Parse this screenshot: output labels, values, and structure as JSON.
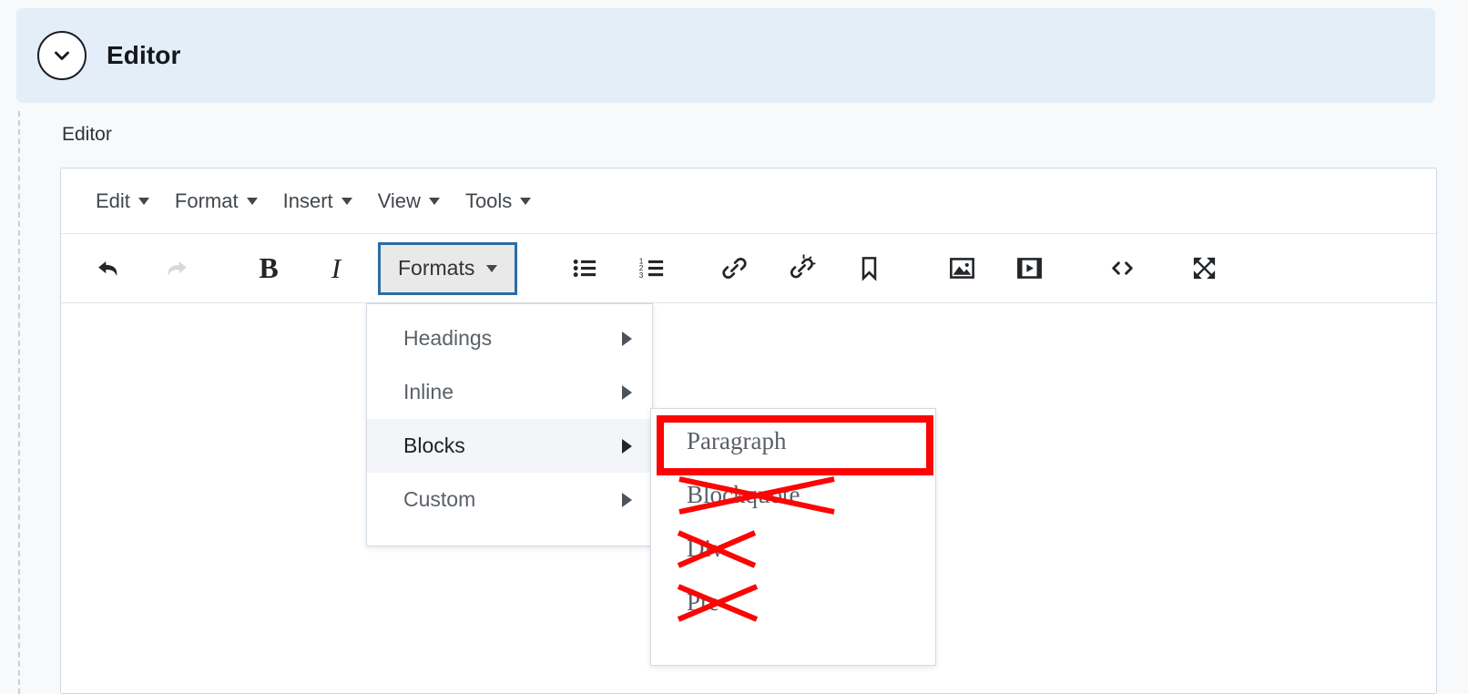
{
  "banner": {
    "title": "Editor",
    "toggle_icon": "chevron-down-icon",
    "background_color": "#e3eef8"
  },
  "field": {
    "label": "Editor"
  },
  "menubar": {
    "items": [
      {
        "label": "Edit",
        "icon": "caret-down-icon"
      },
      {
        "label": "Format",
        "icon": "caret-down-icon"
      },
      {
        "label": "Insert",
        "icon": "caret-down-icon"
      },
      {
        "label": "View",
        "icon": "caret-down-icon"
      },
      {
        "label": "Tools",
        "icon": "caret-down-icon"
      }
    ]
  },
  "toolbar": {
    "undo": {
      "name": "undo-icon",
      "enabled": true
    },
    "redo": {
      "name": "redo-icon",
      "enabled": false
    },
    "bold": {
      "label": "B",
      "name": "bold-icon"
    },
    "italic": {
      "label": "I",
      "name": "italic-icon"
    },
    "formats_button": {
      "label": "Formats",
      "caret": "caret-down-icon",
      "focus_border_color": "#2c6ca4",
      "background_color": "#e9e9e9"
    },
    "icons": [
      "bullet-list-icon",
      "numbered-list-icon",
      "link-icon",
      "unlink-icon",
      "bookmark-icon",
      "image-icon",
      "media-icon",
      "source-code-icon",
      "fullscreen-icon"
    ]
  },
  "formats_dropdown": {
    "items": [
      {
        "label": "Headings",
        "has_submenu": true,
        "active": false
      },
      {
        "label": "Inline",
        "has_submenu": true,
        "active": false
      },
      {
        "label": "Blocks",
        "has_submenu": true,
        "active": true
      },
      {
        "label": "Custom",
        "has_submenu": true,
        "active": false
      }
    ]
  },
  "blocks_submenu": {
    "items": [
      {
        "label": "Paragraph",
        "crossed_out": false,
        "highlighted": true
      },
      {
        "label": "Blockquote",
        "crossed_out": true,
        "highlighted": false
      },
      {
        "label": "Div",
        "crossed_out": true,
        "highlighted": false
      },
      {
        "label": "Pre",
        "crossed_out": true,
        "highlighted": false
      }
    ]
  },
  "annotation": {
    "color": "#fb0505",
    "target_label": "Paragraph"
  }
}
